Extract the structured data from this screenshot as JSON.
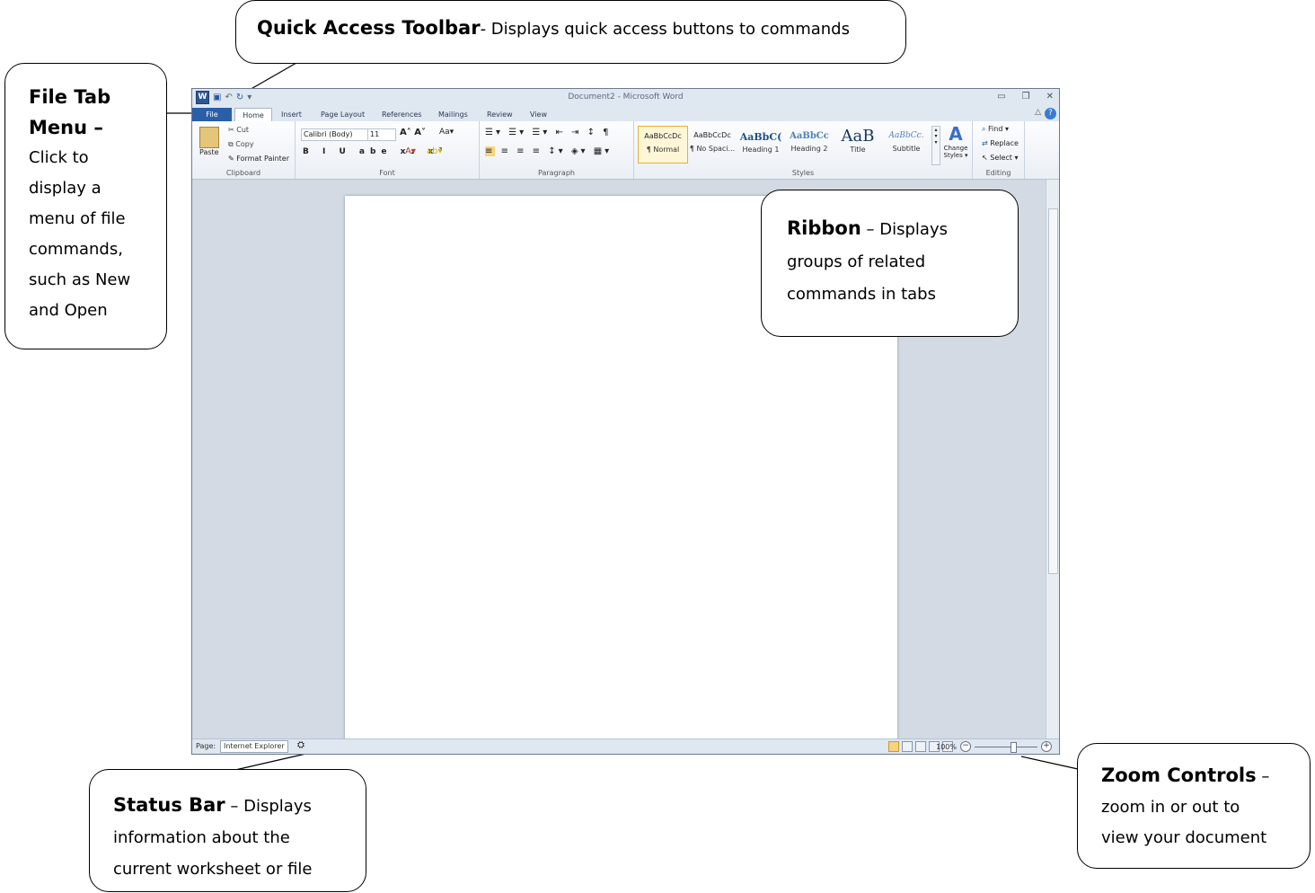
{
  "callouts": {
    "qat": {
      "title": "Quick Access Toolbar",
      "body": "- Displays quick access buttons to commands"
    },
    "file_tab": {
      "title_1": "File Tab",
      "title_2": "Menu –",
      "body": [
        "Click to",
        "display a",
        "menu of file",
        "commands,",
        "such as New",
        "and Open"
      ]
    },
    "ribbon": {
      "title": "Ribbon",
      "dash": " – ",
      "body_1": "Displays",
      "body_2": "groups of related",
      "body_3": "commands in tabs"
    },
    "status_bar": {
      "title": "Status Bar",
      "dash": " – ",
      "body_1": "Displays",
      "body_2": "information about the",
      "body_3": "current worksheet or file"
    },
    "zoom_controls": {
      "title": "Zoom Controls",
      "dash": " –",
      "body_1": "zoom in or out to",
      "body_2": "view your document"
    }
  },
  "word": {
    "title": "Document2 - Microsoft Word",
    "logo": "W",
    "tabs": [
      "File",
      "Home",
      "Insert",
      "Page Layout",
      "References",
      "Mailings",
      "Review",
      "View"
    ],
    "clipboard": {
      "paste": "Paste",
      "cut": "Cut",
      "copy": "Copy",
      "format_painter": "Format Painter",
      "label": "Clipboard"
    },
    "font": {
      "family": "Calibri (Body)",
      "size": "11",
      "label": "Font",
      "format_row": "B I U abe x₂ x²"
    },
    "paragraph": {
      "label": "Paragraph"
    },
    "styles": {
      "label": "Styles",
      "items": [
        {
          "sample": "AaBbCcDc",
          "name": "¶ Normal"
        },
        {
          "sample": "AaBbCcDc",
          "name": "¶ No Spaci..."
        },
        {
          "sample": "AaBbC(",
          "name": "Heading 1"
        },
        {
          "sample": "AaBbCc",
          "name": "Heading 2"
        },
        {
          "sample": "AaB",
          "name": "Title"
        },
        {
          "sample": "AaBbCc.",
          "name": "Subtitle"
        }
      ],
      "change_styles_1": "Change",
      "change_styles_2": "Styles ▾"
    },
    "editing": {
      "find": "Find ▾",
      "replace": "Replace",
      "select": "Select ▾",
      "label": "Editing"
    },
    "status": {
      "page_label": "Page:",
      "page_value": "Internet Explorer"
    },
    "zoom": {
      "level": "100%",
      "minus": "−",
      "plus": "+"
    }
  },
  "colors": {
    "file_tab": "#2a5ea8",
    "window_bg": "#d3dae3"
  },
  "icons": [
    "word-logo-icon",
    "save-icon",
    "undo-icon",
    "redo-icon",
    "help-icon",
    "minimize-icon",
    "restore-icon",
    "close-icon",
    "paste-icon",
    "find-icon",
    "zoom-slider-icon"
  ]
}
